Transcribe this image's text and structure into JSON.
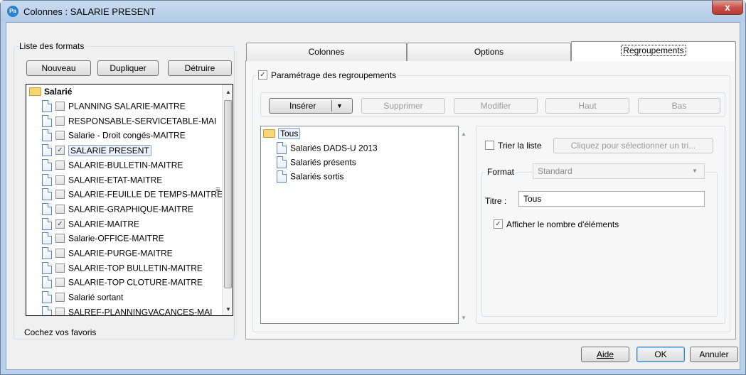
{
  "window": {
    "title": "Colonnes : SALARIE PRESENT",
    "app_badge": "Pa",
    "close_glyph": "x"
  },
  "formats": {
    "group_title": "Liste des formats",
    "buttons": {
      "new": "Nouveau",
      "duplicate": "Dupliquer",
      "delete": "Détruire"
    },
    "root_label": "Salarié",
    "items": [
      {
        "label": "PLANNING SALARIE-MAITRE",
        "checked": false
      },
      {
        "label": "RESPONSABLE-SERVICETABLE-MAI",
        "checked": false
      },
      {
        "label": "Salarie - Droit congés-MAITRE",
        "checked": false
      },
      {
        "label": "SALARIE PRESENT",
        "checked": true,
        "selected": true
      },
      {
        "label": "SALARIE-BULLETIN-MAITRE",
        "checked": false
      },
      {
        "label": "SALARIE-ETAT-MAITRE",
        "checked": false
      },
      {
        "label": "SALARIE-FEUILLE DE TEMPS-MAITRE",
        "checked": false
      },
      {
        "label": "SALARIE-GRAPHIQUE-MAITRE",
        "checked": false
      },
      {
        "label": "SALARIE-MAITRE",
        "checked": true
      },
      {
        "label": "Salarie-OFFICE-MAITRE",
        "checked": false
      },
      {
        "label": "SALARIE-PURGE-MAITRE",
        "checked": false
      },
      {
        "label": "SALARIE-TOP BULLETIN-MAITRE",
        "checked": false
      },
      {
        "label": "SALARIE-TOP CLOTURE-MAITRE",
        "checked": false
      },
      {
        "label": "Salarié sortant",
        "checked": false
      },
      {
        "label": "SALREF-PLANNINGVACANCES-MAI",
        "checked": false
      }
    ],
    "footer": "Cochez vos favoris"
  },
  "tabs": [
    {
      "label": "Colonnes",
      "active": false
    },
    {
      "label": "Options",
      "active": false
    },
    {
      "label": "Regroupements",
      "active": true
    }
  ],
  "regroup": {
    "enable_label": "Paramétrage des regroupements",
    "enable_checked": true,
    "toolbar": {
      "insert": "Insérer",
      "delete": "Supprimer",
      "edit": "Modifier",
      "up": "Haut",
      "down": "Bas"
    },
    "tree_root": "Tous",
    "tree_items": [
      "Salariés DADS-U 2013",
      "Salariés présents",
      "Salariés sortis"
    ],
    "sort_label": "Trier la liste",
    "sort_button": "Cliquez pour sélectionner un tri...",
    "format_label": "Format",
    "format_value": "Standard",
    "title_label": "Titre :",
    "title_value": "Tous",
    "count_label": "Afficher le nombre d'éléments",
    "count_checked": true
  },
  "footer_buttons": {
    "help": "Aide",
    "ok": "OK",
    "cancel": "Annuler"
  }
}
